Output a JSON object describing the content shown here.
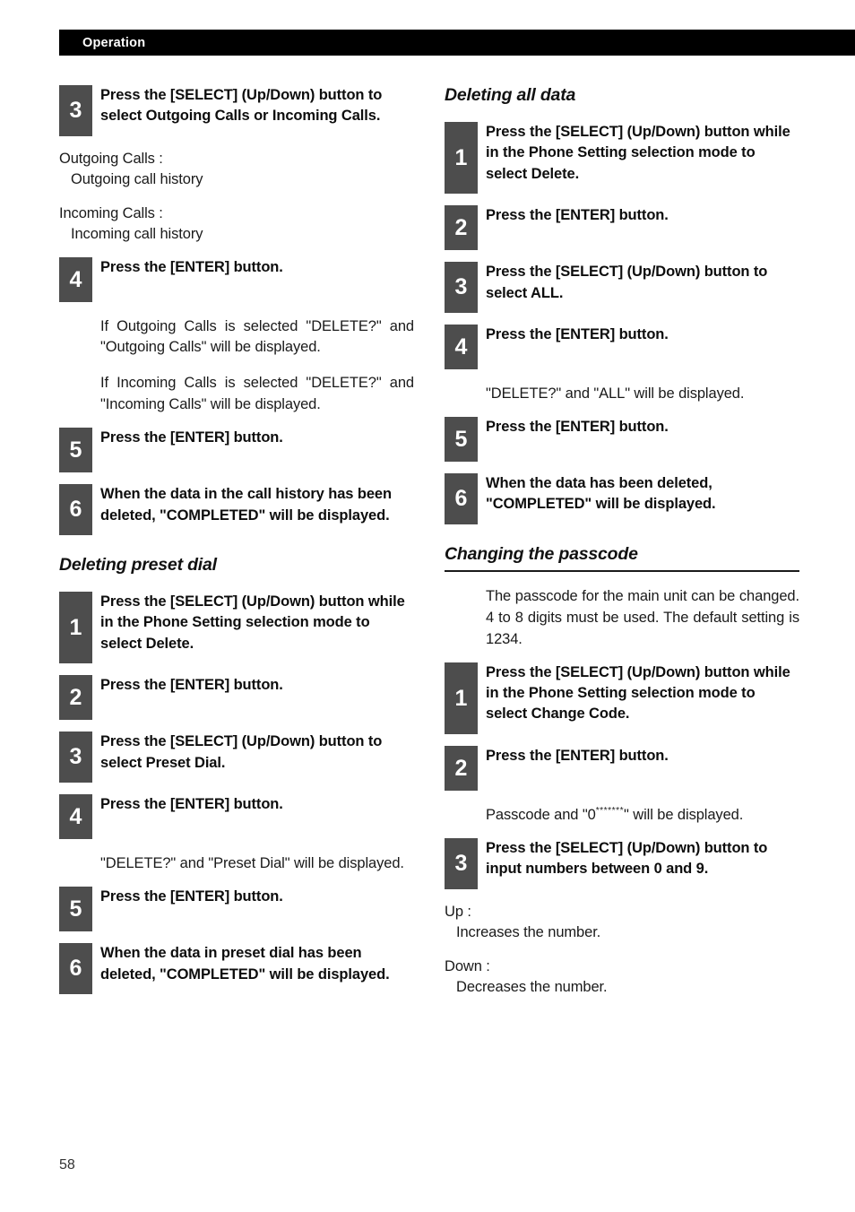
{
  "header": {
    "title": "Operation"
  },
  "page_number": "58",
  "left_column": {
    "blocks": [
      {
        "kind": "step",
        "number": "3",
        "title": "Press the [SELECT] (Up/Down) button to select Outgoing Calls or Incoming Calls."
      },
      {
        "kind": "definition",
        "term": "Outgoing Calls :",
        "desc": "Outgoing call history"
      },
      {
        "kind": "definition",
        "term": "Incoming Calls :",
        "desc": "Incoming call history"
      },
      {
        "kind": "step",
        "number": "4",
        "title": "Press the [ENTER] button."
      },
      {
        "kind": "paragraph",
        "text": "If Outgoing Calls is selected \"DELETE?\" and \"Outgoing Calls\" will be displayed."
      },
      {
        "kind": "paragraph",
        "text": "If Incoming Calls is selected \"DELETE?\" and \"Incoming Calls\" will be displayed."
      },
      {
        "kind": "step",
        "number": "5",
        "title": "Press the [ENTER] button."
      },
      {
        "kind": "step",
        "number": "6",
        "title": "When the data in the call history has been deleted, \"COMPLETED\" will be displayed."
      },
      {
        "kind": "heading",
        "text": "Deleting preset dial",
        "rule": false
      },
      {
        "kind": "step",
        "number": "1",
        "title": "Press the [SELECT] (Up/Down) button while in the Phone Setting selection mode to select Delete."
      },
      {
        "kind": "step",
        "number": "2",
        "title": "Press the [ENTER] button."
      },
      {
        "kind": "step",
        "number": "3",
        "title": "Press the [SELECT] (Up/Down) button to select Preset Dial."
      },
      {
        "kind": "step",
        "number": "4",
        "title": "Press the [ENTER] button."
      },
      {
        "kind": "paragraph",
        "text": "\"DELETE?\" and \"Preset Dial\" will be displayed."
      },
      {
        "kind": "step",
        "number": "5",
        "title": "Press the [ENTER] button."
      },
      {
        "kind": "step",
        "number": "6",
        "title": "When the data in preset dial has been deleted, \"COMPLETED\" will be displayed."
      }
    ]
  },
  "right_column": {
    "blocks": [
      {
        "kind": "heading",
        "text": "Deleting all data",
        "rule": false
      },
      {
        "kind": "step",
        "number": "1",
        "title": "Press the [SELECT] (Up/Down) button while in the Phone Setting selection mode to select Delete."
      },
      {
        "kind": "step",
        "number": "2",
        "title": "Press the [ENTER] button."
      },
      {
        "kind": "step",
        "number": "3",
        "title": "Press the [SELECT] (Up/Down) button to select ALL."
      },
      {
        "kind": "step",
        "number": "4",
        "title": "Press the [ENTER] button."
      },
      {
        "kind": "paragraph",
        "text": "\"DELETE?\" and \"ALL\" will be displayed."
      },
      {
        "kind": "step",
        "number": "5",
        "title": "Press the [ENTER] button."
      },
      {
        "kind": "step",
        "number": "6",
        "title": "When the data has been deleted, \"COMPLETED\" will be displayed."
      },
      {
        "kind": "heading",
        "text": "Changing the passcode",
        "rule": true
      },
      {
        "kind": "paragraph",
        "text": "The passcode for the main unit can be changed. 4 to 8 digits must be used. The default setting is 1234."
      },
      {
        "kind": "step",
        "number": "1",
        "title": "Press the [SELECT] (Up/Down) button while in the Phone Setting selection mode to select Change Code."
      },
      {
        "kind": "step",
        "number": "2",
        "title": "Press the [ENTER] button."
      },
      {
        "kind": "paragraph_stars",
        "before": "Passcode and \"0",
        "stars": "*******",
        "after": "\" will be displayed."
      },
      {
        "kind": "step",
        "number": "3",
        "title": "Press the [SELECT] (Up/Down) button to input numbers between 0 and 9."
      },
      {
        "kind": "definition",
        "term": "Up :",
        "desc": "Increases the number."
      },
      {
        "kind": "definition",
        "term": "Down :",
        "desc": "Decreases the number."
      }
    ]
  }
}
